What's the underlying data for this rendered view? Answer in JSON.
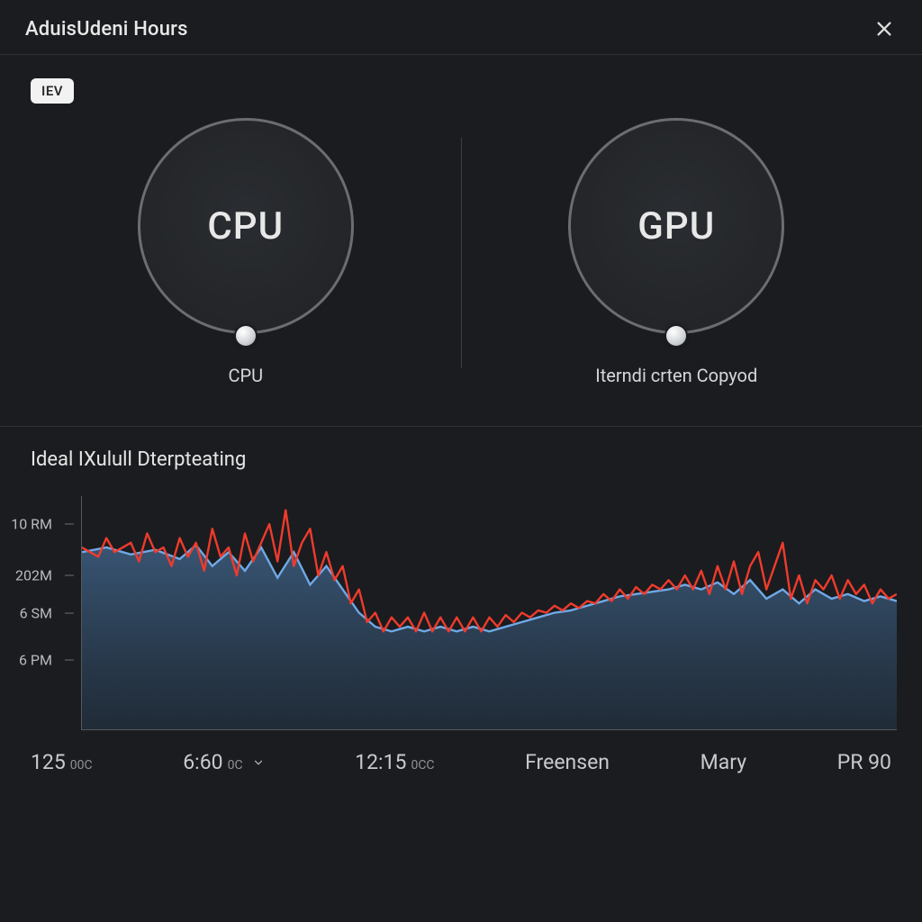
{
  "header": {
    "title": "AduisUdeni Hours"
  },
  "top": {
    "mode_chip": "IEV",
    "gauges": [
      {
        "ring_label": "CPU",
        "caption": "CPU"
      },
      {
        "ring_label": "GPU",
        "caption": "Iterndi crten Copyod"
      }
    ]
  },
  "chart_section_title": "Ideal IXulull Dterpteating",
  "chart_data": {
    "type": "area",
    "y_ticks": [
      "10 RM",
      "202M",
      "6 SM",
      "6 PM"
    ],
    "y_tick_positions_pct": [
      12,
      34,
      50,
      70
    ],
    "x_ticks": [
      {
        "label": "125",
        "unit": "00C"
      },
      {
        "label": "6:60",
        "unit": "0C",
        "has_dropdown": true
      },
      {
        "label": "12:15",
        "unit": "0CC"
      },
      {
        "label": "Freensen"
      },
      {
        "label": "Mary"
      },
      {
        "label": "PR 90"
      }
    ],
    "series": [
      {
        "name": "area_blue",
        "role": "area",
        "color_stroke": "#6fa9e6",
        "color_fill_top": "#3a5878",
        "color_fill_bottom": "#22303f",
        "points_pct": [
          [
            0,
            24
          ],
          [
            3,
            22
          ],
          [
            6,
            25
          ],
          [
            9,
            23
          ],
          [
            12,
            27
          ],
          [
            14,
            21
          ],
          [
            16,
            30
          ],
          [
            18,
            24
          ],
          [
            20,
            32
          ],
          [
            22,
            22
          ],
          [
            24,
            35
          ],
          [
            26,
            24
          ],
          [
            28,
            38
          ],
          [
            30,
            30
          ],
          [
            32,
            40
          ],
          [
            34,
            50
          ],
          [
            36,
            56
          ],
          [
            38,
            58
          ],
          [
            40,
            56
          ],
          [
            42,
            58
          ],
          [
            44,
            56
          ],
          [
            46,
            58
          ],
          [
            48,
            56
          ],
          [
            50,
            58
          ],
          [
            52,
            56
          ],
          [
            54,
            54
          ],
          [
            56,
            52
          ],
          [
            58,
            50
          ],
          [
            60,
            49
          ],
          [
            62,
            47
          ],
          [
            64,
            45
          ],
          [
            66,
            43
          ],
          [
            68,
            42
          ],
          [
            70,
            41
          ],
          [
            72,
            40
          ],
          [
            74,
            38
          ],
          [
            76,
            40
          ],
          [
            78,
            37
          ],
          [
            80,
            42
          ],
          [
            82,
            36
          ],
          [
            84,
            44
          ],
          [
            86,
            40
          ],
          [
            88,
            46
          ],
          [
            90,
            40
          ],
          [
            92,
            44
          ],
          [
            94,
            42
          ],
          [
            96,
            45
          ],
          [
            98,
            43
          ],
          [
            100,
            45
          ]
        ]
      },
      {
        "name": "line_red",
        "role": "line",
        "color_stroke": "#ef3b2c",
        "points_pct": [
          [
            0,
            22
          ],
          [
            2,
            26
          ],
          [
            3,
            18
          ],
          [
            4,
            24
          ],
          [
            6,
            20
          ],
          [
            7,
            28
          ],
          [
            8,
            16
          ],
          [
            9,
            24
          ],
          [
            10,
            22
          ],
          [
            11,
            30
          ],
          [
            12,
            18
          ],
          [
            13,
            26
          ],
          [
            14,
            20
          ],
          [
            15,
            32
          ],
          [
            16,
            14
          ],
          [
            17,
            26
          ],
          [
            18,
            22
          ],
          [
            19,
            34
          ],
          [
            20,
            16
          ],
          [
            21,
            28
          ],
          [
            22,
            20
          ],
          [
            23,
            12
          ],
          [
            24,
            28
          ],
          [
            25,
            6
          ],
          [
            26,
            30
          ],
          [
            27,
            20
          ],
          [
            28,
            14
          ],
          [
            29,
            34
          ],
          [
            30,
            24
          ],
          [
            31,
            36
          ],
          [
            32,
            30
          ],
          [
            33,
            46
          ],
          [
            34,
            40
          ],
          [
            35,
            54
          ],
          [
            36,
            50
          ],
          [
            37,
            58
          ],
          [
            38,
            52
          ],
          [
            39,
            56
          ],
          [
            40,
            52
          ],
          [
            41,
            58
          ],
          [
            42,
            50
          ],
          [
            43,
            58
          ],
          [
            44,
            52
          ],
          [
            45,
            58
          ],
          [
            46,
            52
          ],
          [
            47,
            58
          ],
          [
            48,
            52
          ],
          [
            49,
            58
          ],
          [
            50,
            52
          ],
          [
            51,
            56
          ],
          [
            52,
            51
          ],
          [
            53,
            54
          ],
          [
            54,
            50
          ],
          [
            55,
            52
          ],
          [
            56,
            49
          ],
          [
            57,
            50
          ],
          [
            58,
            47
          ],
          [
            59,
            49
          ],
          [
            60,
            46
          ],
          [
            61,
            48
          ],
          [
            62,
            45
          ],
          [
            63,
            46
          ],
          [
            64,
            42
          ],
          [
            65,
            45
          ],
          [
            66,
            40
          ],
          [
            67,
            44
          ],
          [
            68,
            39
          ],
          [
            69,
            42
          ],
          [
            70,
            38
          ],
          [
            71,
            40
          ],
          [
            72,
            36
          ],
          [
            73,
            40
          ],
          [
            74,
            34
          ],
          [
            75,
            40
          ],
          [
            76,
            32
          ],
          [
            77,
            42
          ],
          [
            78,
            30
          ],
          [
            79,
            40
          ],
          [
            80,
            28
          ],
          [
            81,
            42
          ],
          [
            82,
            30
          ],
          [
            83,
            24
          ],
          [
            84,
            40
          ],
          [
            85,
            30
          ],
          [
            86,
            20
          ],
          [
            87,
            44
          ],
          [
            88,
            34
          ],
          [
            89,
            46
          ],
          [
            90,
            36
          ],
          [
            91,
            40
          ],
          [
            92,
            34
          ],
          [
            93,
            44
          ],
          [
            94,
            36
          ],
          [
            95,
            42
          ],
          [
            96,
            38
          ],
          [
            97,
            46
          ],
          [
            98,
            40
          ],
          [
            99,
            44
          ],
          [
            100,
            42
          ]
        ]
      }
    ]
  }
}
